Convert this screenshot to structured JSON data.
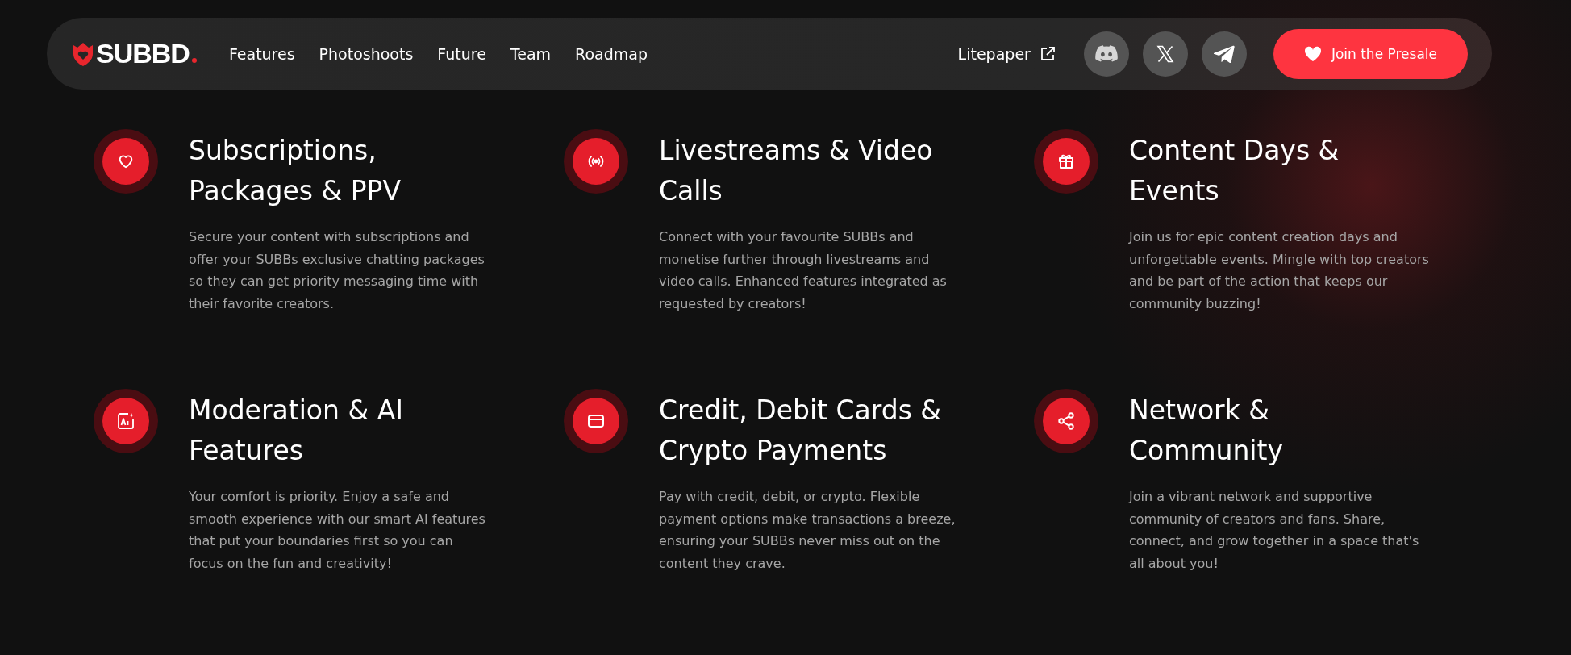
{
  "nav": {
    "logo": "SUBBD",
    "links": [
      {
        "label": "Features"
      },
      {
        "label": "Photoshoots"
      },
      {
        "label": "Future"
      },
      {
        "label": "Team"
      },
      {
        "label": "Roadmap"
      }
    ],
    "litepaper": "Litepaper",
    "socials": [
      {
        "kind": "discord"
      },
      {
        "kind": "x"
      },
      {
        "kind": "telegram"
      }
    ],
    "cta": "Join the Presale"
  },
  "features": [
    {
      "title": "Subscriptions, Packages & PPV",
      "text": "Secure your content with subscriptions and offer your SUBBs exclusive chatting packages so they can get priority messaging time with their favorite creators."
    },
    {
      "title": "Livestreams & Video Calls",
      "text": "Connect with your favourite SUBBs and monetise further through livestreams and video calls. Enhanced features integrated as requested by creators!"
    },
    {
      "title": "Content Days & Events",
      "text": "Join us for epic content creation days and unforgettable events. Mingle with top creators and be part of the action that keeps our community buzzing!"
    },
    {
      "title": "Moderation & AI Features",
      "text": "Your comfort is priority. Enjoy a safe and smooth experience with our smart AI features that put your boundaries first so you can focus on the fun and creativity!"
    },
    {
      "title": "Credit, Debit Cards & Crypto Payments",
      "text": "Pay with credit, debit, or crypto. Flexible payment options make transactions a breeze, ensuring your SUBBs never miss out on the content they crave."
    },
    {
      "title": "Network & Community",
      "text": "Join a vibrant network and supportive community of creators and fans. Share, connect, and grow together in a space that's all about you!"
    }
  ]
}
